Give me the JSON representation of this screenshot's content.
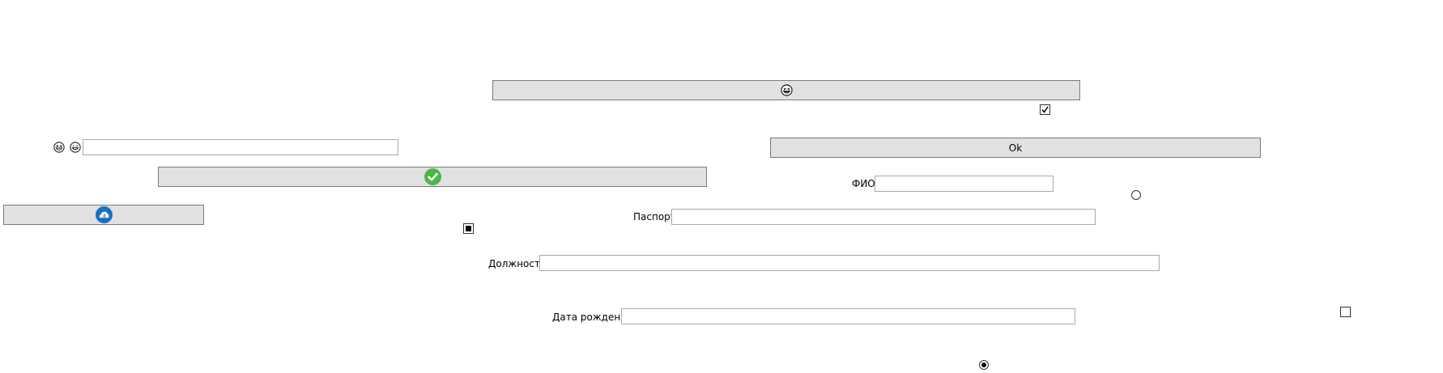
{
  "buttons": {
    "top": {
      "label": "",
      "icon": "grinning-squint-face-icon"
    },
    "ok": {
      "label": "Ok"
    },
    "checkmark": {
      "label": "",
      "icon": "green-check-circle-icon",
      "color": "#4cb648"
    },
    "cloud": {
      "label": "",
      "icon": "blue-cloud-circle-icon",
      "color": "#1b6fc2"
    }
  },
  "emoji_row": {
    "icons": [
      "grinning-squint-face-icon",
      "grinning-face-icon"
    ],
    "value": ""
  },
  "fields": {
    "fio": {
      "label": "ФИО",
      "value": ""
    },
    "passport": {
      "label": "Паспорт",
      "value": ""
    },
    "position": {
      "label": "Должность",
      "value": ""
    },
    "birthdate": {
      "label": "Дата рождения",
      "value": ""
    }
  },
  "controls": {
    "checkbox_top": {
      "checked": true
    },
    "checkbox_indeterminate": {
      "state": "indeterminate"
    },
    "checkbox_right": {
      "checked": false
    },
    "radio_top": {
      "checked": false
    },
    "radio_bottom": {
      "checked": true
    }
  },
  "colors": {
    "button_bg": "#e1e1e1",
    "border": "#7a7a7a",
    "field_border": "#a9a9a9"
  }
}
